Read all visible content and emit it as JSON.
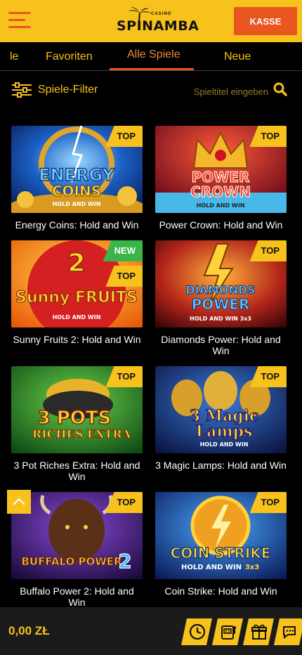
{
  "header": {
    "logo_text": "SPINAMBA",
    "logo_small": "CASINO",
    "cash_button": "KASSE"
  },
  "tabs": [
    {
      "label": "le"
    },
    {
      "label": "Favoriten"
    },
    {
      "label": "Alle Spiele",
      "active": true
    },
    {
      "label": "Neue"
    }
  ],
  "filter": {
    "label": "Spiele-Filter",
    "search_placeholder": "Spieltitel eingeben"
  },
  "games": [
    {
      "title": "Energy Coins: Hold and Win",
      "art_line1": "ENERGY",
      "art_line2": "COINS",
      "art_line3": "HOLD AND WIN",
      "badges": [
        "TOP"
      ]
    },
    {
      "title": "Power Crown: Hold and Win",
      "art_line1": "POWER",
      "art_line2": "CROWN",
      "art_line3": "HOLD AND WIN",
      "badges": [
        "TOP"
      ]
    },
    {
      "title": "Sunny Fruits 2: Hold and Win",
      "art_line1": "2",
      "art_line2": "Sunny FRUITS",
      "art_line3": "HOLD AND WIN",
      "badges": [
        "NEW",
        "TOP"
      ]
    },
    {
      "title": "Diamonds Power: Hold and Win",
      "art_line1": "DIAMONDS",
      "art_line2": "POWER",
      "art_line3": "HOLD AND WIN 3x3",
      "badges": [
        "TOP"
      ]
    },
    {
      "title": "3 Pot Riches Extra: Hold and Win",
      "art_line1": "3 POTS",
      "art_line2": "RICHES EXTRA",
      "art_line3": "",
      "badges": [
        "TOP"
      ]
    },
    {
      "title": "3 Magic Lamps: Hold and Win",
      "art_line1": "3 Magic",
      "art_line2": "Lamps",
      "art_line3": "HOLD AND WIN",
      "badges": [
        "TOP"
      ]
    },
    {
      "title": "Buffalo Power 2: Hold and Win",
      "art_line1": "BUFFALO POWER",
      "art_line2": "2",
      "art_line3": "",
      "badges": [
        "TOP"
      ]
    },
    {
      "title": "Coin Strike: Hold and Win",
      "art_line1": "COIN STRIKE",
      "art_line2": "HOLD AND WIN",
      "art_line3": "3x3",
      "badges": [
        "TOP"
      ]
    }
  ],
  "footer": {
    "balance": "0,00 ZŁ",
    "icons": [
      "clock-icon",
      "slot-machine-icon",
      "gift-icon",
      "chat-icon"
    ]
  },
  "colors": {
    "brand_yellow": "#f7c21c",
    "accent_orange": "#e9561f",
    "new_green": "#39b54a",
    "background": "#000000"
  }
}
